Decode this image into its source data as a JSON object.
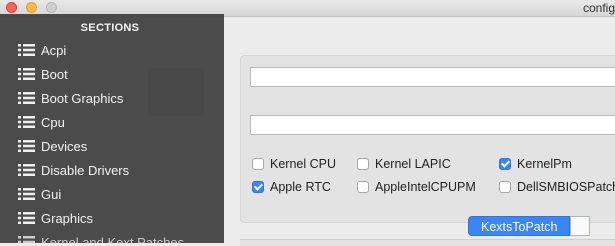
{
  "window": {
    "title": "config"
  },
  "sidebar": {
    "heading": "SECTIONS",
    "items": [
      {
        "label": "Acpi",
        "icon": "list-icon"
      },
      {
        "label": "Boot",
        "icon": "list-icon"
      },
      {
        "label": "Boot Graphics",
        "icon": "list-icon"
      },
      {
        "label": "Cpu",
        "icon": "list-icon"
      },
      {
        "label": "Devices",
        "icon": "list-icon"
      },
      {
        "label": "Disable Drivers",
        "icon": "list-icon"
      },
      {
        "label": "Gui",
        "icon": "list-icon"
      },
      {
        "label": "Graphics",
        "icon": "list-icon"
      },
      {
        "label": "Kernel and Kext Patches",
        "icon": "list-icon"
      }
    ]
  },
  "main": {
    "text_field_1": "",
    "text_field_2": "",
    "checkboxes": [
      {
        "label": "Kernel CPU",
        "checked": false
      },
      {
        "label": "Kernel LAPIC",
        "checked": false
      },
      {
        "label": "KernelPm",
        "checked": true
      },
      {
        "label": "Apple RTC",
        "checked": true
      },
      {
        "label": "AppleIntelCPUPM",
        "checked": false
      },
      {
        "label": "DellSMBIOSPatch",
        "checked": false
      }
    ],
    "tabs": [
      {
        "label": "KextsToPatch",
        "active": true
      }
    ]
  },
  "colors": {
    "accent": "#3b86f7",
    "sidebar_bg": "#444444",
    "window_bg": "#ececec"
  }
}
